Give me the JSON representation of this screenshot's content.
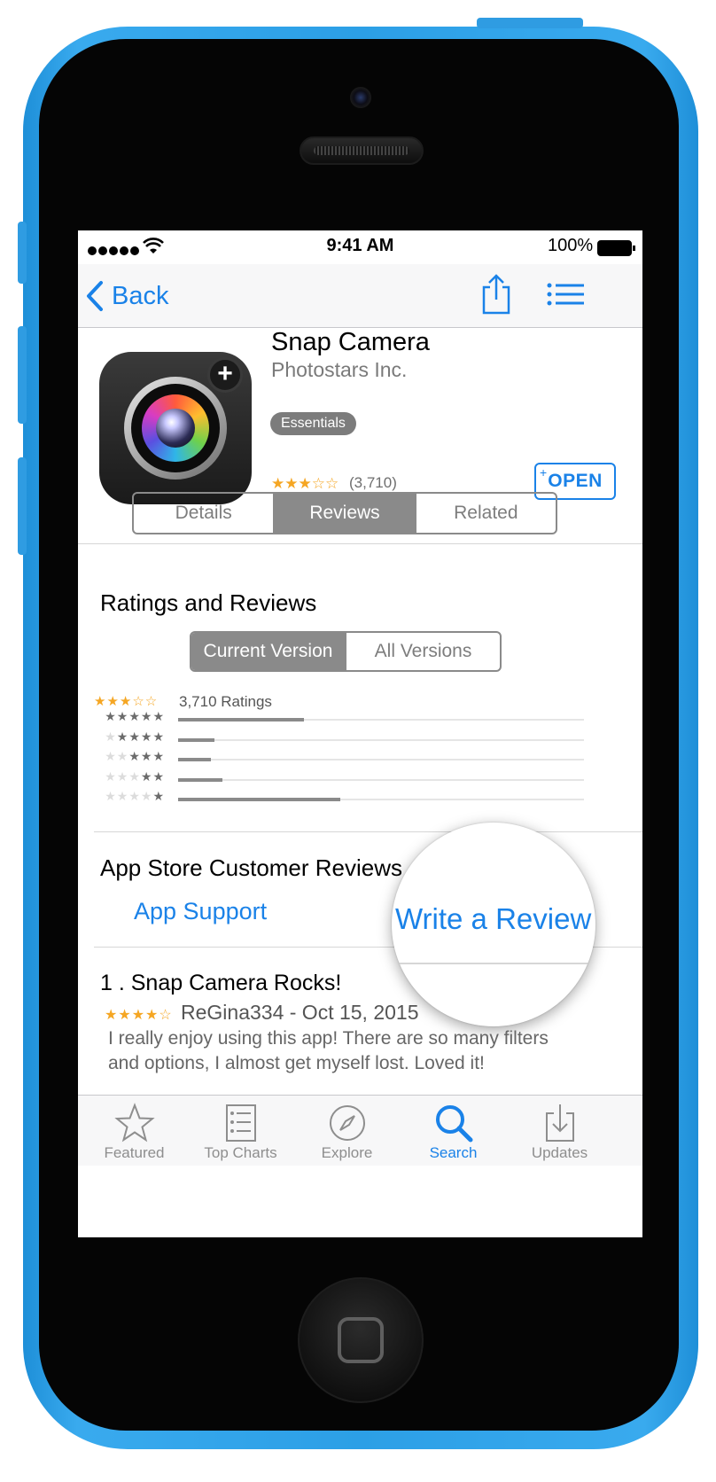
{
  "status_bar": {
    "time": "9:41 AM",
    "battery": "100%"
  },
  "nav": {
    "back_label": "Back"
  },
  "app": {
    "name": "Snap Camera",
    "developer": "Photostars Inc.",
    "badge": "Essentials",
    "rating_count": "(3,710)",
    "rating_stars": 3,
    "open_label": "OPEN",
    "open_plus": "+"
  },
  "tabs": [
    "Details",
    "Reviews",
    "Related"
  ],
  "selected_tab": "Reviews",
  "ratings": {
    "heading": "Ratings and Reviews",
    "version_tabs": [
      "Current Version",
      "All Versions"
    ],
    "total_label": "3,710 Ratings",
    "histogram": [
      {
        "stars": 5,
        "fraction": 0.31
      },
      {
        "stars": 4,
        "fraction": 0.09
      },
      {
        "stars": 3,
        "fraction": 0.08
      },
      {
        "stars": 2,
        "fraction": 0.11
      },
      {
        "stars": 1,
        "fraction": 0.4
      }
    ]
  },
  "customer_reviews": {
    "heading": "App Store Customer Reviews",
    "support_link": "App Support",
    "write_review": "Write a Review"
  },
  "review": {
    "title": "1 . Snap Camera Rocks!",
    "stars": 4,
    "author_date": "ReGina334 - Oct 15, 2015",
    "body_line1": "I really enjoy using this app! There are so many filters",
    "body_line2": "and options, I almost get myself lost. Loved it!"
  },
  "tab_bar": [
    {
      "label": "Featured",
      "icon": "star-icon"
    },
    {
      "label": "Top Charts",
      "icon": "list-icon"
    },
    {
      "label": "Explore",
      "icon": "compass-icon"
    },
    {
      "label": "Search",
      "icon": "search-icon",
      "active": true
    },
    {
      "label": "Updates",
      "icon": "download-icon"
    }
  ],
  "colors": {
    "accent": "#1a82e8",
    "star": "#f5a623",
    "phone_body": "#2c9fe6"
  }
}
